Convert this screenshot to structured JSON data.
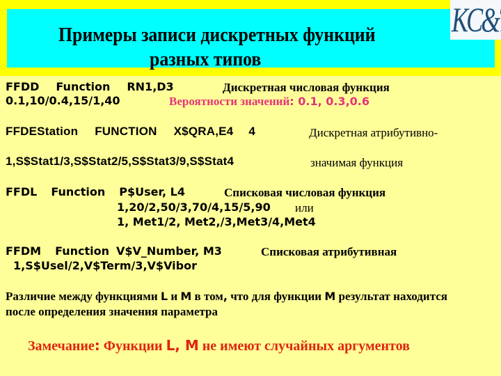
{
  "header": {
    "title_line1": "Примеры записи дискретных функций",
    "title_line2": "разных типов",
    "logo_text": "KC&T",
    "colors": {
      "band": "#ffff00",
      "title_box": "#00ffff",
      "logo": "#1f4f78"
    }
  },
  "colors": {
    "background": "#ffff99",
    "pink": "#e5347a",
    "remark": "#e0250e"
  },
  "blocks": {
    "ffdd": {
      "name": "FFDD",
      "keyword": "Function",
      "params": "RN1,D3",
      "description": "Дискретная числовая функция",
      "values": "0.1,10/0.4,15/1,40",
      "prob_label": "Вероятности значений",
      "prob_colon": ":",
      "prob_values": " 0.1, 0.3,0.6"
    },
    "ffdestation": {
      "name": "FFDEStation",
      "keyword": "FUNCTION",
      "params": "X$QRA,E4",
      "count": "4",
      "description_1": "Дискретная атрибутивно-",
      "values": "1,S$Stat1/3,S$Stat2/5,S$Stat3/9,S$Stat4",
      "description_2": "значимая функция"
    },
    "ffdl": {
      "name": "FFDL",
      "keyword": "Function",
      "params": "P$User, L4",
      "description": "Списковая числовая функция",
      "values_1": "1,20/2,50/3,70/4,15/5,90",
      "or_label": "или",
      "values_2": "1, Met1/2, Met2,/3,Met3/4,Met4"
    },
    "ffdm": {
      "name": "FFDM",
      "keyword": "Function",
      "params": "V$V_Number, M3",
      "description": "Списковая атрибутивная",
      "values": "1,S$Usel/2,V$Term/3,V$Vibor"
    }
  },
  "note": {
    "part1": "Различие между функциями ",
    "letter_l": "L",
    "part2": " и ",
    "letter_m": "M",
    "part3": " в том",
    "comma": ",",
    "part4": " что для функции ",
    "letter_m2": "M",
    "part5": " результат находится",
    "line2": "после определения значения параметра"
  },
  "remark": {
    "label": "Замечание",
    "colon": ":",
    "part1": " Функции ",
    "letters": "L, M",
    "part2": " не имеют случайных аргументов"
  }
}
